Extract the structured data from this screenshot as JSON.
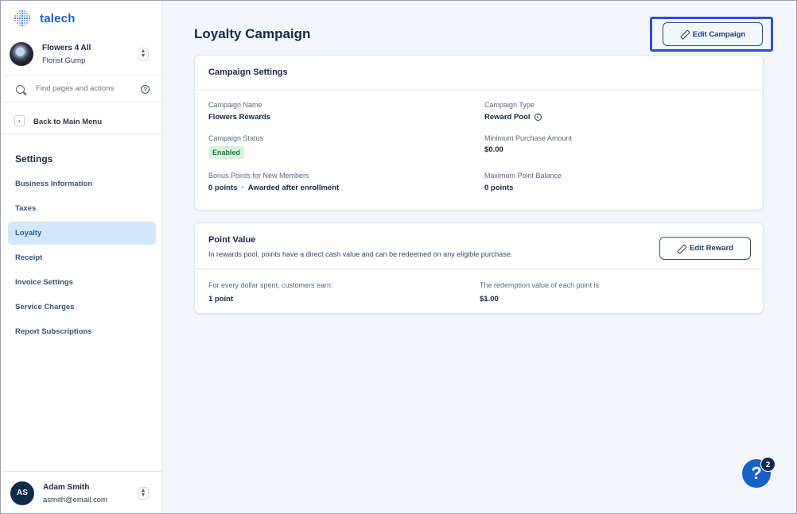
{
  "brand": {
    "name": "talech"
  },
  "business": {
    "name": "Flowers 4 All",
    "subtitle": "Florist Gump"
  },
  "search": {
    "placeholder": "Find pages and actions"
  },
  "back": {
    "label": "Back to Main Menu"
  },
  "sidebar": {
    "section_title": "Settings",
    "items": [
      {
        "label": "Business Information",
        "active": false
      },
      {
        "label": "Taxes",
        "active": false
      },
      {
        "label": "Loyalty",
        "active": true
      },
      {
        "label": "Receipt",
        "active": false
      },
      {
        "label": "Invoice Settings",
        "active": false
      },
      {
        "label": "Service Charges",
        "active": false
      },
      {
        "label": "Report Subscriptions",
        "active": false
      }
    ]
  },
  "user": {
    "initials": "AS",
    "name": "Adam Smith",
    "email": "asmith@email.com"
  },
  "page": {
    "title": "Loyalty Campaign",
    "edit_button": "Edit Campaign"
  },
  "campaign_settings": {
    "title": "Campaign Settings",
    "name_label": "Campaign Name",
    "name_value": "Flowers Rewards",
    "type_label": "Campaign Type",
    "type_value": "Reward Pool",
    "status_label": "Campaign Status",
    "status_value": "Enabled",
    "min_purchase_label": "Minimum Purchase Amount",
    "min_purchase_value": "$0.00",
    "bonus_label": "Bonus Points for New Members",
    "bonus_value": "0 points  ·  Awarded after enrollment",
    "max_balance_label": "Maximum Point Balance",
    "max_balance_value": "0 points"
  },
  "point_value": {
    "title": "Point Value",
    "description": "In rewards pool, points have a direct cash value and can be redeemed on any eligible purchase.",
    "edit_button": "Edit Reward",
    "earn_label": "For every dollar spent, customers earn:",
    "earn_value": "1 point",
    "redeem_label": "The redemption value of each point is",
    "redeem_value": "$1.00"
  },
  "help": {
    "symbol": "?",
    "badge_count": "2"
  },
  "colors": {
    "accent": "#1660c7",
    "active_nav": "#d3e7fb",
    "highlight_border": "#2f4fd6",
    "status_enabled": "#d7f2df"
  }
}
